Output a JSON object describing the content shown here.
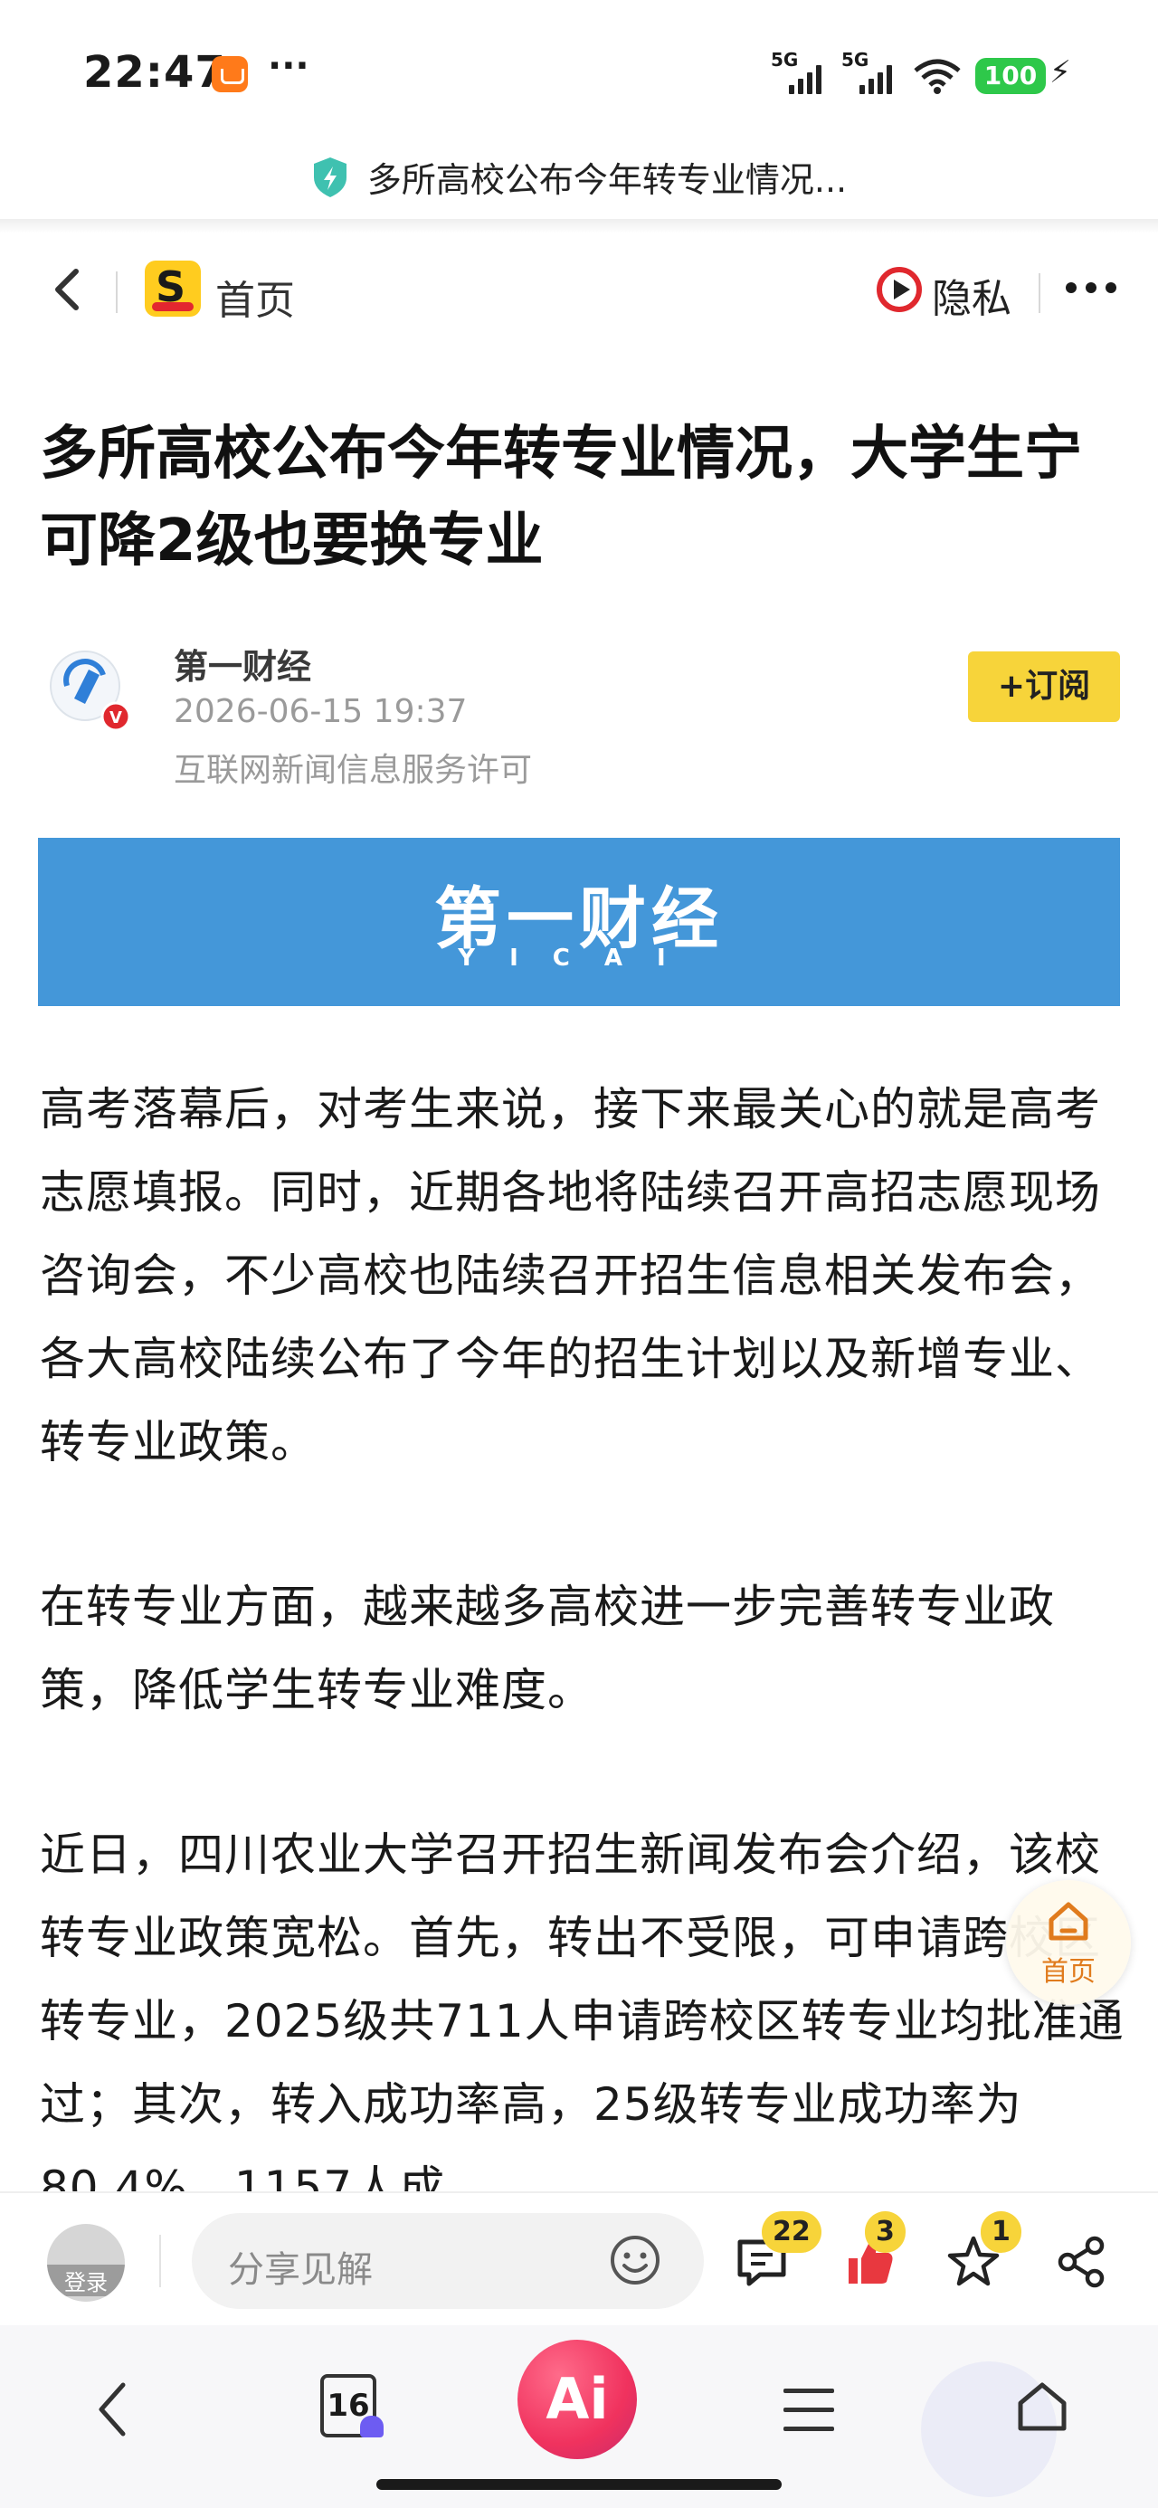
{
  "status_bar": {
    "time": "22:47",
    "more": "···",
    "signal1_label": "5G",
    "signal2_label": "5G",
    "battery": "100",
    "icons": [
      "shop-icon",
      "signal-icon",
      "signal-icon",
      "wifi-icon",
      "battery-icon",
      "charging-icon"
    ]
  },
  "page_title": "多所高校公布今年转专业情况...",
  "nav": {
    "home_label": "首页",
    "privacy_label": "隐私"
  },
  "article": {
    "headline": "多所高校公布今年转专业情况，大学生宁可降2级也要换专业",
    "author": "第一财经",
    "published": "2026-06-15 19:37",
    "license": "互联网新闻信息服务许可",
    "subscribe_label": "+订阅",
    "banner_logo": "第一财经",
    "banner_sub": "YICAI",
    "paragraphs": [
      "高考落幕后，对考生来说，接下来最关心的就是高考志愿填报。同时，近期各地将陆续召开高招志愿现场咨询会，不少高校也陆续召开招生信息相关发布会，各大高校陆续公布了今年的招生计划以及新增专业、转专业政策。",
      "在转专业方面，越来越多高校进一步完善转专业政策，降低学生转专业难度。",
      "近日，四川农业大学召开招生新闻发布会介绍，该校转专业政策宽松。首先，转出不受限，可申请跨校区转专业，2025级共711人申请跨校区转专业均批准通过；其次，转入成功率高，25级转专业成功率为80.4%，1157人成"
    ]
  },
  "float_home_label": "首页",
  "comment_bar": {
    "login_label": "登录",
    "placeholder": "分享见解",
    "comment_count": "22",
    "like_count": "3",
    "favorite_count": "1"
  },
  "browser_bar": {
    "tab_count": "16",
    "ai_label": "Ai"
  },
  "colors": {
    "accent_yellow": "#f7d43a",
    "banner_blue": "#4497d9",
    "ai_red": "#f0325e",
    "battery_green": "#2ec84a"
  }
}
